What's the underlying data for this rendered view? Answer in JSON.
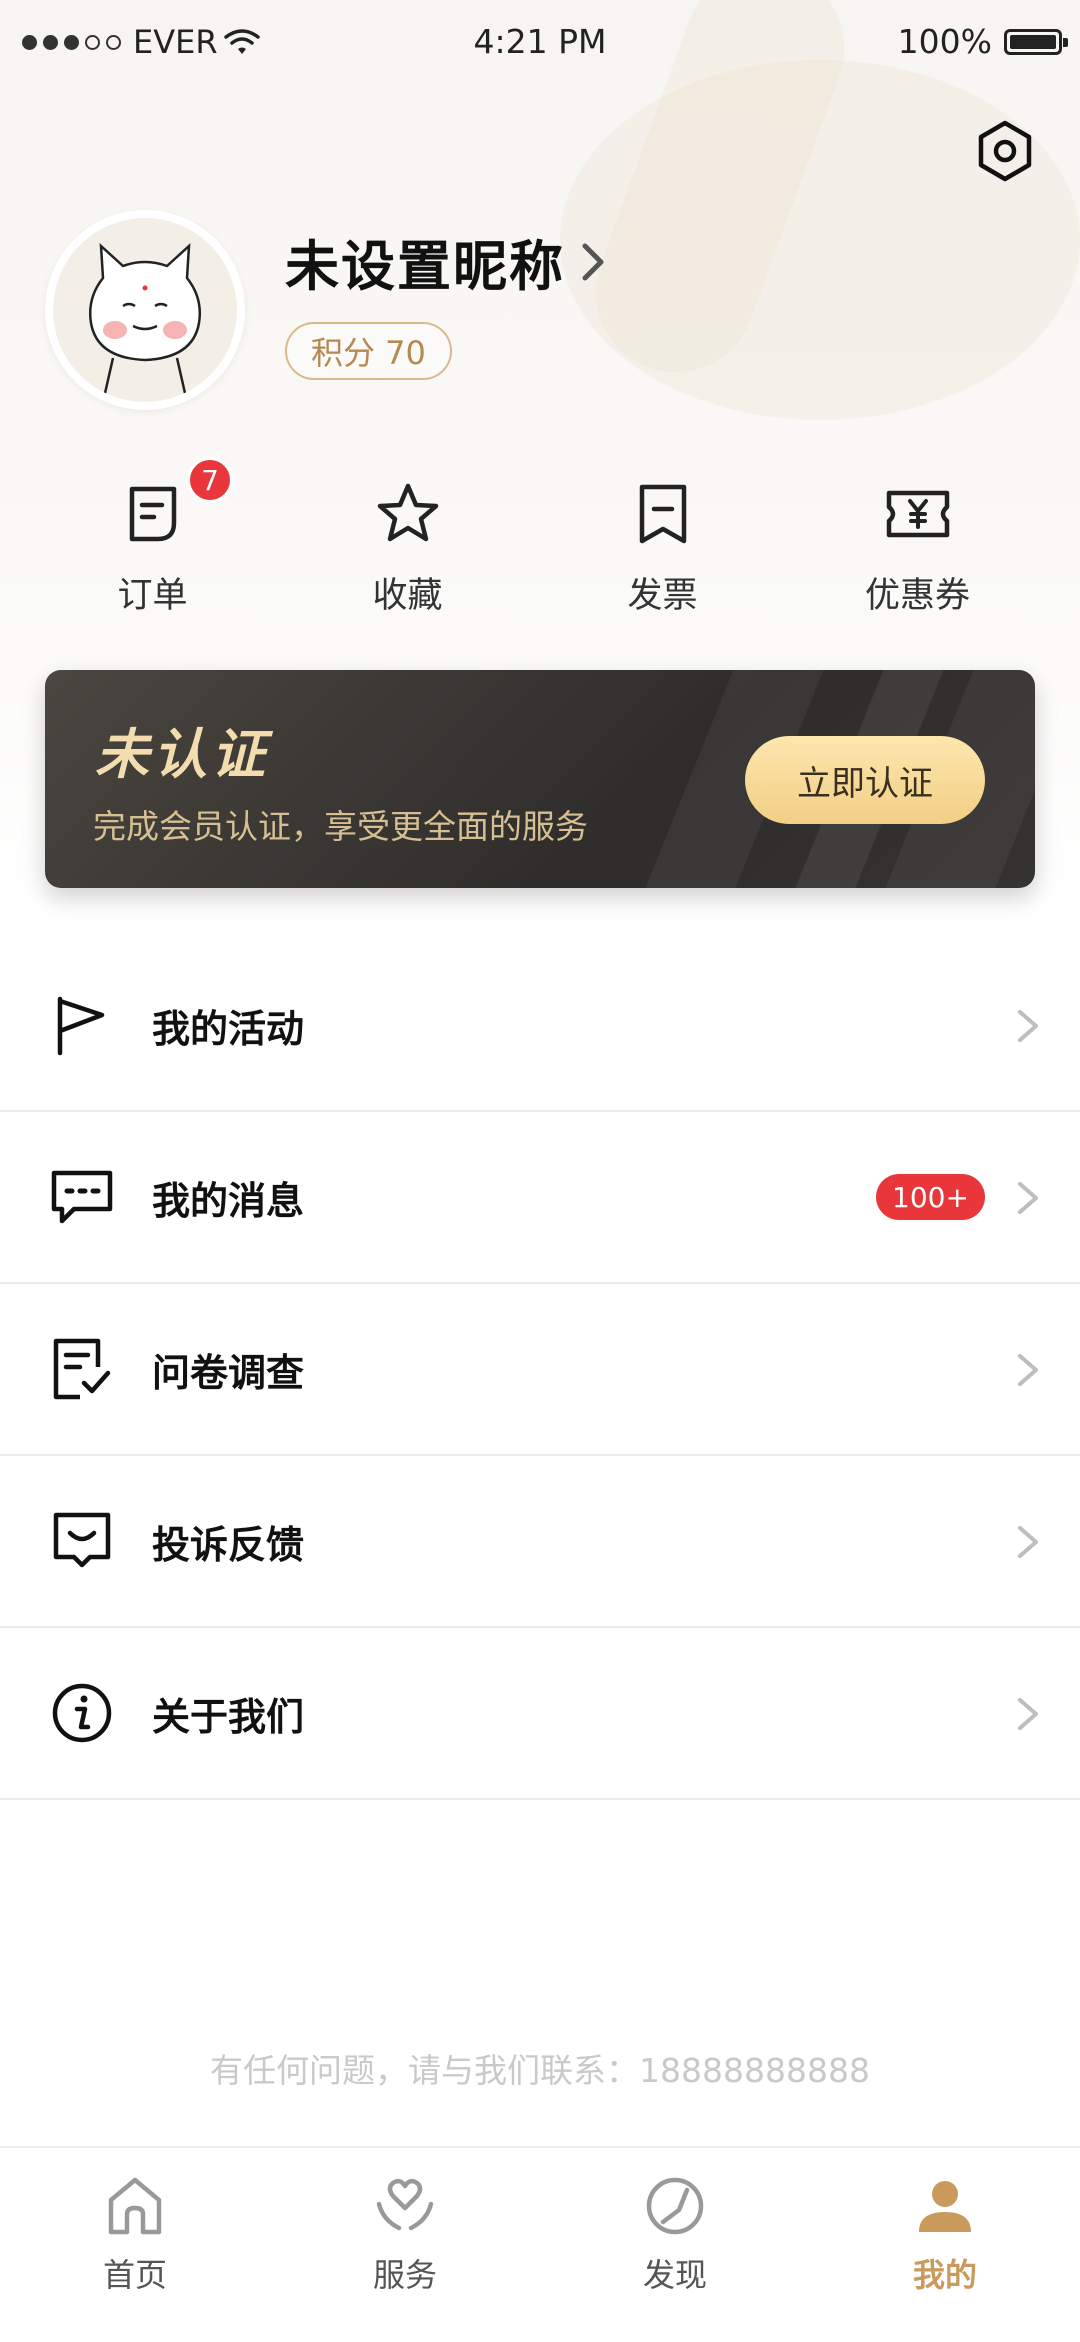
{
  "status_bar": {
    "carrier": "EVER",
    "time": "4:21 PM",
    "battery": "100%"
  },
  "profile": {
    "nickname": "未设置昵称",
    "points_label": "积分 70"
  },
  "quick_actions": [
    {
      "label": "订单",
      "icon": "order-icon",
      "badge": "7"
    },
    {
      "label": "收藏",
      "icon": "star-icon"
    },
    {
      "label": "发票",
      "icon": "invoice-icon"
    },
    {
      "label": "优惠券",
      "icon": "coupon-icon"
    }
  ],
  "verify_banner": {
    "title": "未认证",
    "subtitle": "完成会员认证，享受更全面的服务",
    "button_label": "立即认证"
  },
  "menu": [
    {
      "label": "我的活动",
      "icon": "flag-icon"
    },
    {
      "label": "我的消息",
      "icon": "message-icon",
      "badge": "100+"
    },
    {
      "label": "问卷调查",
      "icon": "survey-icon"
    },
    {
      "label": "投诉反馈",
      "icon": "feedback-icon"
    },
    {
      "label": "关于我们",
      "icon": "info-icon"
    }
  ],
  "contact_text": "有任何问题，请与我们联系：18888888888",
  "tabbar": [
    {
      "label": "首页",
      "icon": "home-icon"
    },
    {
      "label": "服务",
      "icon": "heart-hands-icon"
    },
    {
      "label": "发现",
      "icon": "compass-icon"
    },
    {
      "label": "我的",
      "icon": "user-icon",
      "active": true
    }
  ],
  "colors": {
    "accent": "#c99a5b",
    "badge_red": "#e8363a",
    "banner_dark": "#2f2d2b",
    "banner_gold": "#f3dcae"
  }
}
